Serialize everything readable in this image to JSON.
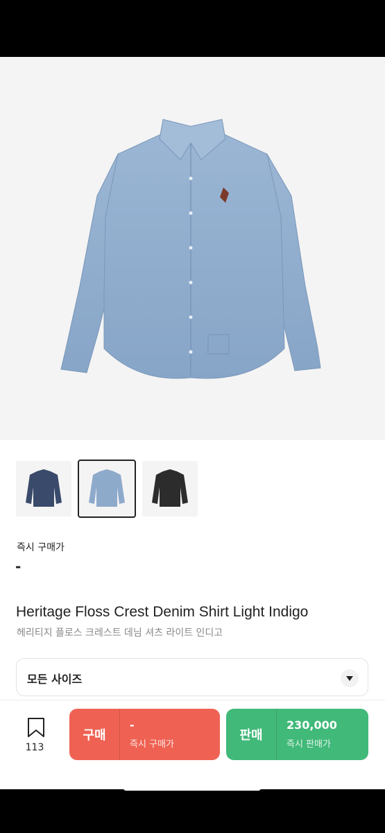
{
  "product": {
    "instant_buy_label": "즉시 구매가",
    "instant_buy_price": "-",
    "title_en": "Heritage Floss Crest Denim Shirt Light Indigo",
    "title_ko": "헤리티지 플로스 크레스트 데님 셔츠 라이트 인디고",
    "thumbnails": [
      {
        "color": "#3a4a6b"
      },
      {
        "color": "#8eaacb",
        "selected": true
      },
      {
        "color": "#2c2c2c"
      }
    ]
  },
  "size_select": {
    "label": "모든 사이즈",
    "icon": "chevron-down-icon"
  },
  "bottom_bar": {
    "wish_count": "113",
    "buy": {
      "label": "구매",
      "price": "-",
      "sub": "즉시 구매가",
      "color": "#ef6253"
    },
    "sell": {
      "label": "판매",
      "price": "230,000",
      "sub": "즉시 판매가",
      "color": "#41b979"
    }
  }
}
